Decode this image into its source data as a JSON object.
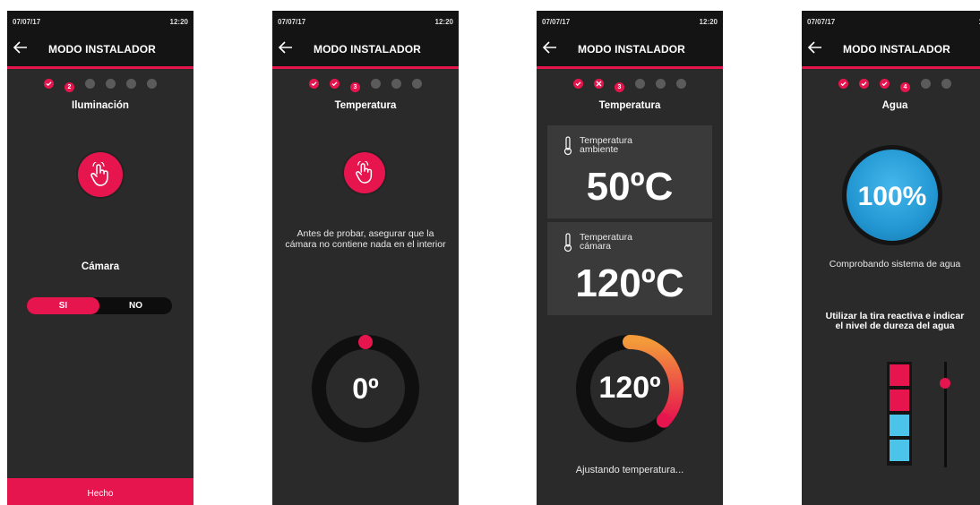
{
  "common": {
    "date": "07/07/17",
    "time": "12:20",
    "title": "MODO INSTALADOR",
    "accent": "#e6154e"
  },
  "screen1": {
    "steps": [
      {
        "state": "done",
        "label": ""
      },
      {
        "state": "active",
        "label": "2"
      },
      {
        "state": "todo",
        "label": ""
      },
      {
        "state": "todo",
        "label": ""
      },
      {
        "state": "todo",
        "label": ""
      },
      {
        "state": "todo",
        "label": ""
      }
    ],
    "title": "Iluminación",
    "section": "Cámara",
    "toggle_yes": "SI",
    "toggle_no": "NO",
    "done_label": "Hecho"
  },
  "screen2": {
    "steps": [
      {
        "state": "done",
        "label": ""
      },
      {
        "state": "done",
        "label": ""
      },
      {
        "state": "active",
        "label": "3"
      },
      {
        "state": "todo",
        "label": ""
      },
      {
        "state": "todo",
        "label": ""
      },
      {
        "state": "todo",
        "label": ""
      }
    ],
    "title": "Temperatura",
    "note": "Antes de probar, asegurar que la cámara no contiene nada en el interior",
    "gauge_value": "0º",
    "gauge_fraction": 0
  },
  "screen3": {
    "steps": [
      {
        "state": "done",
        "label": ""
      },
      {
        "state": "fail",
        "label": ""
      },
      {
        "state": "active",
        "label": "3"
      },
      {
        "state": "todo",
        "label": ""
      },
      {
        "state": "todo",
        "label": ""
      },
      {
        "state": "todo",
        "label": ""
      }
    ],
    "title": "Temperatura",
    "ambient_label_1": "Temperatura",
    "ambient_label_2": "ambiente",
    "ambient_value": "50ºC",
    "chamber_label_1": "Temperatura",
    "chamber_label_2": "cámara",
    "chamber_value": "120ºC",
    "gauge_value": "120º",
    "gauge_fraction": 0.37,
    "status": "Ajustando temperatura..."
  },
  "screen4": {
    "steps": [
      {
        "state": "done",
        "label": ""
      },
      {
        "state": "done",
        "label": ""
      },
      {
        "state": "done",
        "label": ""
      },
      {
        "state": "active",
        "label": "4"
      },
      {
        "state": "todo",
        "label": ""
      },
      {
        "state": "todo",
        "label": ""
      }
    ],
    "title": "Agua",
    "water_level": "100%",
    "checking": "Comprobando sistema de agua",
    "instruction": "Utilizar la tira reactiva e indicar el nivel de dureza del agua",
    "hardness_colors": [
      "#e6154e",
      "#e6154e",
      "#4cc4ea",
      "#4cc4ea"
    ],
    "slider_level": 0.8
  }
}
